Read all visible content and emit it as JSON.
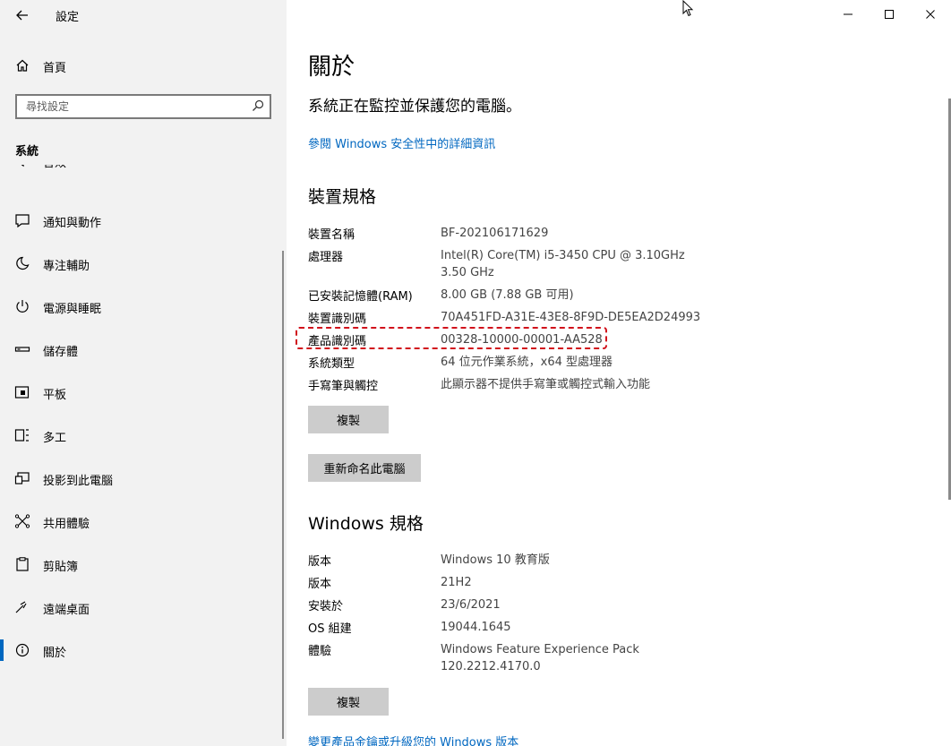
{
  "window": {
    "title": "設定",
    "minimize_icon": "minimize-icon",
    "maximize_icon": "maximize-icon",
    "close_icon": "close-icon"
  },
  "sidebar": {
    "home_label": "首頁",
    "search_placeholder": "尋找設定",
    "section_label": "系統",
    "partial_item_label": "音效",
    "items": [
      {
        "label": "通知與動作",
        "icon": "notification-icon"
      },
      {
        "label": "專注輔助",
        "icon": "moon-icon"
      },
      {
        "label": "電源與睡眠",
        "icon": "power-icon"
      },
      {
        "label": "儲存體",
        "icon": "storage-icon"
      },
      {
        "label": "平板",
        "icon": "tablet-icon"
      },
      {
        "label": "多工",
        "icon": "multitasking-icon"
      },
      {
        "label": "投影到此電腦",
        "icon": "projecting-icon"
      },
      {
        "label": "共用體驗",
        "icon": "shared-icon"
      },
      {
        "label": "剪貼簿",
        "icon": "clipboard-icon"
      },
      {
        "label": "遠端桌面",
        "icon": "remote-desktop-icon"
      },
      {
        "label": "關於",
        "icon": "info-icon",
        "active": true
      }
    ]
  },
  "main": {
    "title": "關於",
    "security_status": "系統正在監控並保護您的電腦。",
    "security_link": "參閱 Windows 安全性中的詳細資訊",
    "device_specs": {
      "heading": "裝置規格",
      "rows": [
        {
          "key": "裝置名稱",
          "value": "BF-202106171629"
        },
        {
          "key": "處理器",
          "value": "Intel(R) Core(TM) i5-3450 CPU @ 3.10GHz   3.50 GHz"
        },
        {
          "key": "已安裝記憶體(RAM)",
          "value": "8.00 GB (7.88 GB 可用)"
        },
        {
          "key": "裝置識別碼",
          "value": "70A451FD-A31E-43E8-8F9D-DE5EA2D24993"
        },
        {
          "key": "產品識別碼",
          "value": "00328-10000-00001-AA528"
        },
        {
          "key": "系統類型",
          "value": "64 位元作業系統，x64 型處理器"
        },
        {
          "key": "手寫筆與觸控",
          "value": "此顯示器不提供手寫筆或觸控式輸入功能"
        }
      ],
      "copy_label": "複製",
      "rename_label": "重新命名此電腦"
    },
    "windows_specs": {
      "heading": "Windows 規格",
      "rows": [
        {
          "key": "版本",
          "value": "Windows 10 教育版"
        },
        {
          "key": "版本",
          "value": "21H2"
        },
        {
          "key": "安裝於",
          "value": "23/6/2021"
        },
        {
          "key": "OS 組建",
          "value": "19044.1645"
        },
        {
          "key": "體驗",
          "value": "Windows Feature Experience Pack 120.2212.4170.0"
        }
      ],
      "copy_label": "複製",
      "upgrade_link": "變更產品金鑰或升級您的 Windows 版本"
    }
  },
  "colors": {
    "accent": "#0067c0",
    "highlight": "#d1111b",
    "sidebar_bg": "#f2f2f2",
    "button_bg": "#cccccc"
  }
}
